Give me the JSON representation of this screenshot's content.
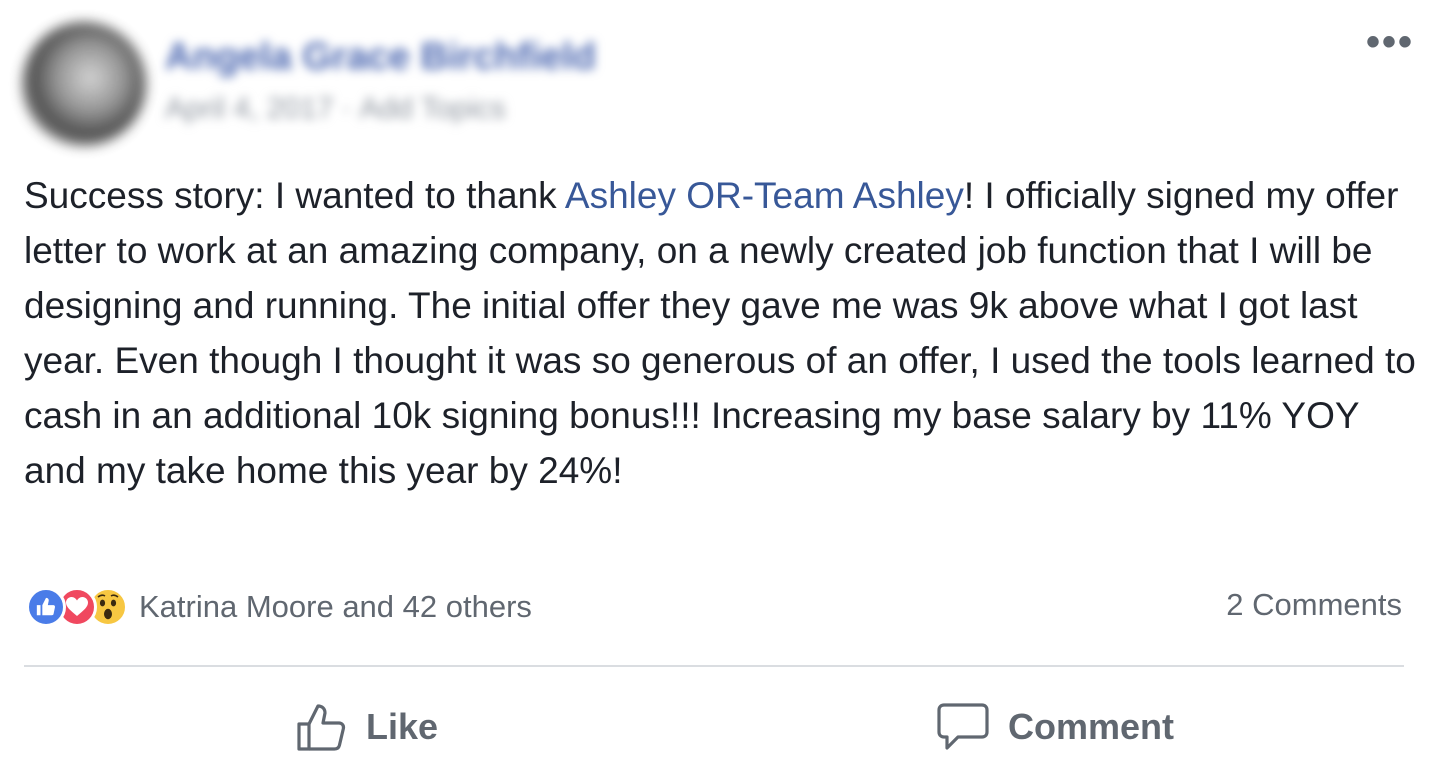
{
  "header": {
    "author_name": "Angela Grace Birchfield",
    "date": "April 4, 2017",
    "separator": "·",
    "topics_label": "Add Topics",
    "more_label": "•••"
  },
  "post": {
    "text_before": "Success story: I wanted to thank ",
    "mention": "Ashley OR-Team Ashley",
    "text_after": "! I officially signed my offer letter to work at an amazing company, on a newly created job function that I will be designing and running. The initial offer they gave me was 9k above what I got last year. Even though I thought it was so generous of an offer, I used the tools learned to cash in an additional 10k signing bonus!!! Increasing my base salary by 11% YOY and my take home this year by 24%!"
  },
  "reactions": {
    "icons": [
      "like-icon",
      "love-icon",
      "wow-icon"
    ],
    "summary": "Katrina Moore and 42 others",
    "comments_count": "2 Comments"
  },
  "actions": {
    "like_label": "Like",
    "comment_label": "Comment"
  },
  "colors": {
    "mention": "#385898",
    "like": "#4a7ce8",
    "love": "#f0485f",
    "wow": "#f7c742",
    "muted": "#606770"
  }
}
